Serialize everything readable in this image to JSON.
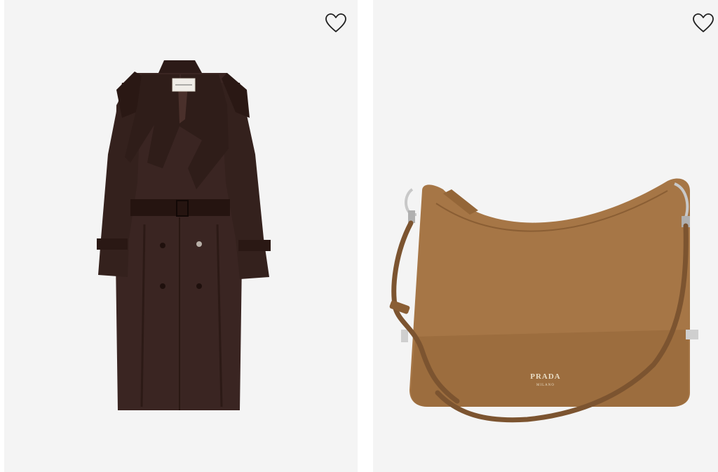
{
  "products": [
    {
      "kind": "trench-coat",
      "wishlist_icon": "heart-outline-icon",
      "colors": {
        "card_bg": "#f4f4f4",
        "coat": "#3a2522",
        "coat_shadow": "#24140f"
      }
    },
    {
      "kind": "shoulder-bag",
      "wishlist_icon": "heart-outline-icon",
      "logo_text": "PRADA",
      "logo_subtext": "MILANO",
      "colors": {
        "card_bg": "#f4f4f4",
        "leather": "#a67646",
        "leather_dark": "#7c5430",
        "hardware": "#c8c8c8"
      }
    }
  ]
}
